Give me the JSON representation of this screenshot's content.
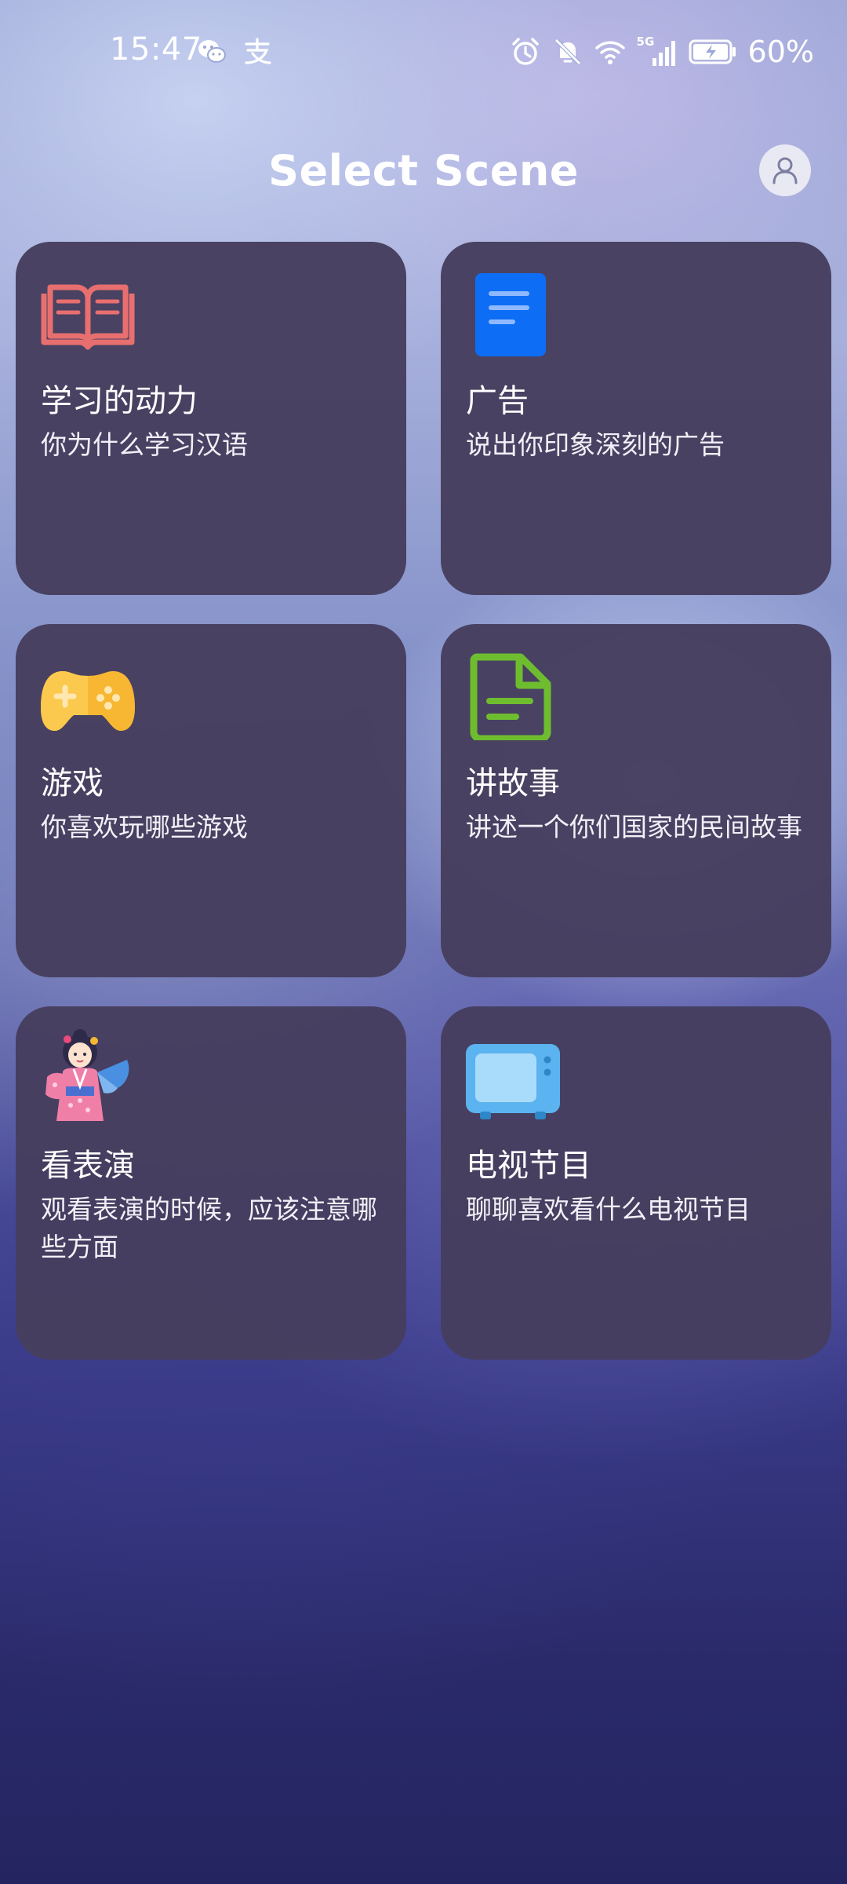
{
  "status_bar": {
    "time": "15:47",
    "battery_percent": "60%",
    "left_icons": [
      "wechat-icon",
      "alipay-icon"
    ],
    "right_icons": [
      "alarm-icon",
      "mute-icon",
      "wifi-icon",
      "5g-signal-icon",
      "battery-charging-icon"
    ],
    "network_label": "5G"
  },
  "header": {
    "title": "Select Scene",
    "profile_icon": "user-icon"
  },
  "scenes": [
    {
      "title": "学习的动力",
      "description": "你为什么学习汉语",
      "icon": "book-icon",
      "accent": "#e86f6f"
    },
    {
      "title": "广告",
      "description": "说出你印象深刻的广告",
      "icon": "document-icon",
      "accent": "#0d6ef5"
    },
    {
      "title": "游戏",
      "description": "你喜欢玩哪些游戏",
      "icon": "gamepad-icon",
      "accent": "#f7b733"
    },
    {
      "title": "讲故事",
      "description": "讲述一个你们国家的民间故事",
      "icon": "file-text-icon",
      "accent": "#6ebd2f"
    },
    {
      "title": "看表演",
      "description": "观看表演的时候，应该注意哪些方面",
      "icon": "kimono-performer-icon",
      "accent": "#f07fa8"
    },
    {
      "title": "电视节目",
      "description": "聊聊喜欢看什么电视节目",
      "icon": "tv-icon",
      "accent": "#5bb3ef"
    }
  ]
}
